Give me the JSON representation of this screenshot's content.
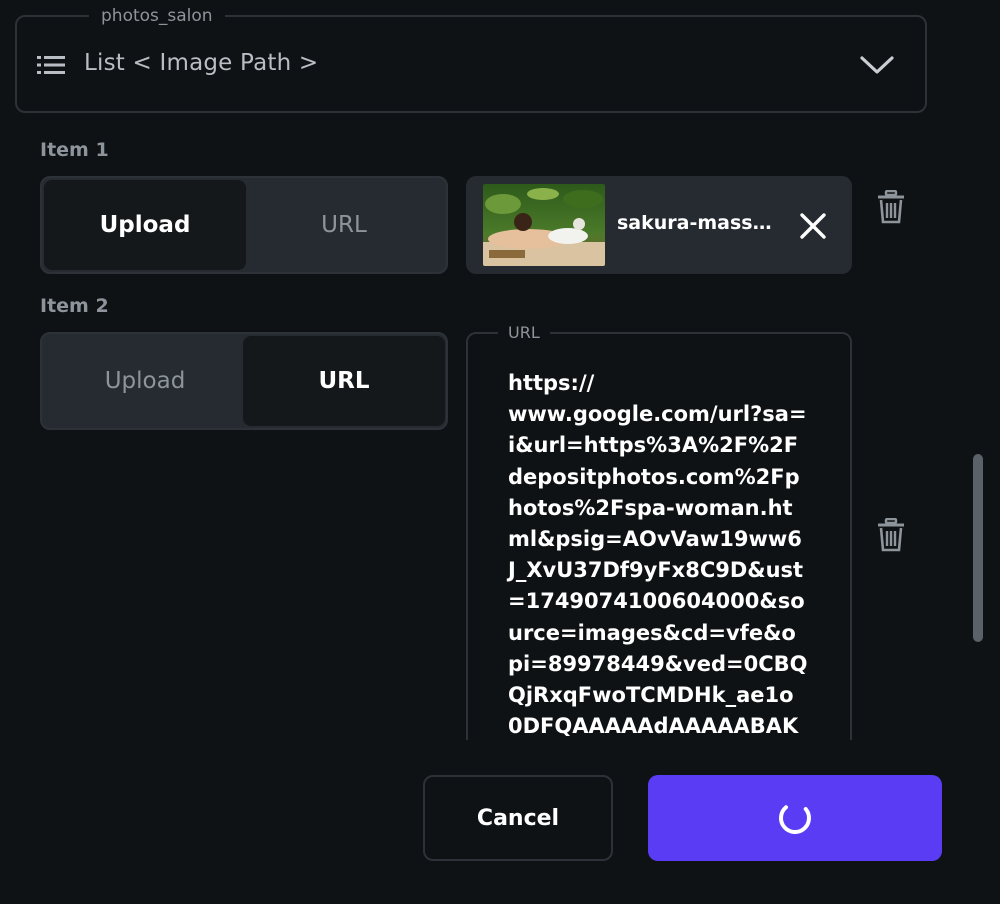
{
  "field": {
    "name": "photos_salon",
    "type_label": "List < Image Path >"
  },
  "items": [
    {
      "label": "Item 1",
      "toggle": {
        "upload_label": "Upload",
        "url_label": "URL",
        "selected": "Upload"
      },
      "file_name": "sakura-massa..."
    },
    {
      "label": "Item 2",
      "toggle": {
        "upload_label": "Upload",
        "url_label": "URL",
        "selected": "URL"
      },
      "url_field_label": "URL",
      "url_value": "https://\nwww.google.com/url?sa=i&url=https%3A%2F%2Fdepositphotos.com%2Fphotos%2Fspa-woman.html&psig=AOvVaw19ww6J_XvU37Df9yFx8C9D&ust=1749074100604000&source=images&cd=vfe&opi=89978449&ved=0CBQQjRxqFwoTCMDHk_ae1o0DFQAAAAAdAAAAABAK"
    }
  ],
  "footer": {
    "cancel_label": "Cancel",
    "submit_state": "loading"
  },
  "icons": {
    "list": "list-icon",
    "expand": "chevron-down-icon",
    "remove": "close-icon",
    "delete": "trash-icon",
    "spinner": "spinner-icon"
  },
  "colors": {
    "background": "#0f1214",
    "panel": "#252b31",
    "border": "#2c3238",
    "active_segment": "#14181b",
    "muted_text": "#8d949b",
    "primary": "#5b3cf5"
  }
}
